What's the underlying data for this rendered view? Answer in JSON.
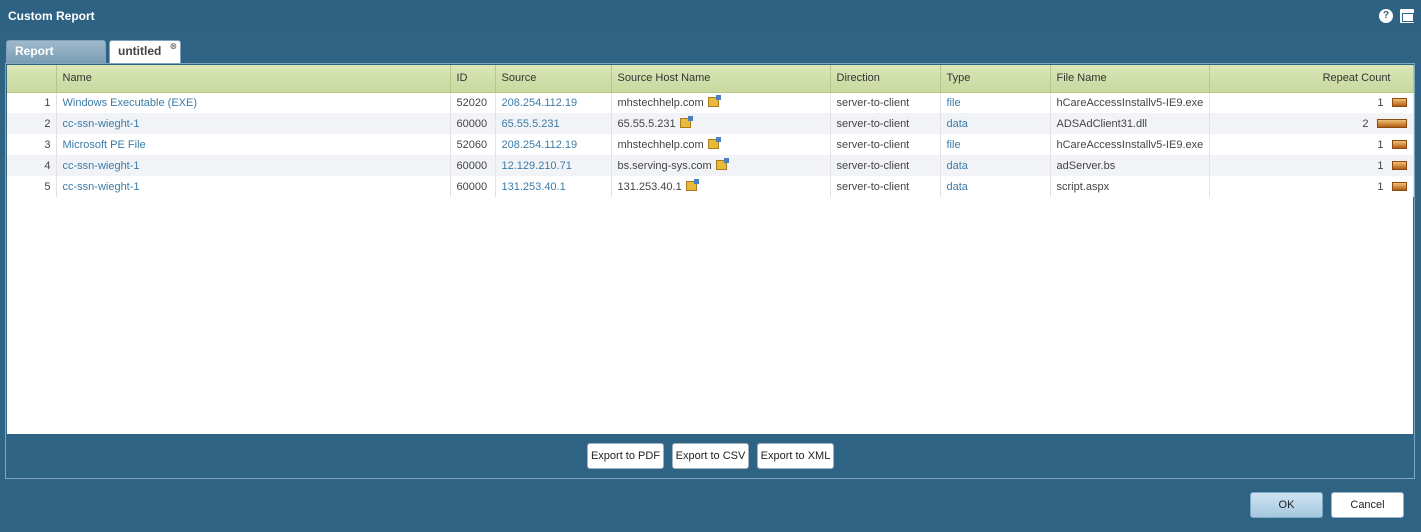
{
  "window": {
    "title": "Custom Report",
    "help_glyph": "?"
  },
  "tabs": [
    {
      "label": "Report Setting"
    },
    {
      "label": "untitled",
      "close_glyph": "⊗"
    }
  ],
  "table": {
    "columns": {
      "num": "",
      "name": "Name",
      "id": "ID",
      "source": "Source",
      "source_host": "Source Host Name",
      "direction": "Direction",
      "type": "Type",
      "file_name": "File Name",
      "repeat_count": "Repeat Count"
    },
    "rows": [
      {
        "num": "1",
        "name": "Windows Executable (EXE)",
        "id": "52020",
        "source": "208.254.112.19",
        "source_host": "mhstechhelp.com",
        "direction": "server-to-client",
        "type": "file",
        "file_name": "hCareAccessInstallv5-IE9.exe",
        "repeat_count": "1",
        "repeat_value": 1
      },
      {
        "num": "2",
        "name": "cc-ssn-wieght-1",
        "id": "60000",
        "source": "65.55.5.231",
        "source_host": "65.55.5.231",
        "direction": "server-to-client",
        "type": "data",
        "file_name": "ADSAdClient31.dll",
        "repeat_count": "2",
        "repeat_value": 2
      },
      {
        "num": "3",
        "name": "Microsoft PE File",
        "id": "52060",
        "source": "208.254.112.19",
        "source_host": "mhstechhelp.com",
        "direction": "server-to-client",
        "type": "file",
        "file_name": "hCareAccessInstallv5-IE9.exe",
        "repeat_count": "1",
        "repeat_value": 1
      },
      {
        "num": "4",
        "name": "cc-ssn-wieght-1",
        "id": "60000",
        "source": "12.129.210.71",
        "source_host": "bs.serving-sys.com",
        "direction": "server-to-client",
        "type": "data",
        "file_name": "adServer.bs",
        "repeat_count": "1",
        "repeat_value": 1
      },
      {
        "num": "5",
        "name": "cc-ssn-wieght-1",
        "id": "60000",
        "source": "131.253.40.1",
        "source_host": "131.253.40.1",
        "direction": "server-to-client",
        "type": "data",
        "file_name": "script.aspx",
        "repeat_count": "1",
        "repeat_value": 1
      }
    ]
  },
  "export_buttons": {
    "pdf": "Export to PDF",
    "csv": "Export to CSV",
    "xml": "Export to XML"
  },
  "dialog_buttons": {
    "ok": "OK",
    "cancel": "Cancel"
  },
  "colors": {
    "window_bg": "#2e6384",
    "header_bg": "#d4e2ad",
    "link": "#3b7ba7",
    "bar": "#d7872c"
  },
  "icons": {
    "help": "help-icon",
    "maximize": "maximize-icon",
    "external_link": "external-link-icon",
    "tab_close": "close-icon"
  }
}
